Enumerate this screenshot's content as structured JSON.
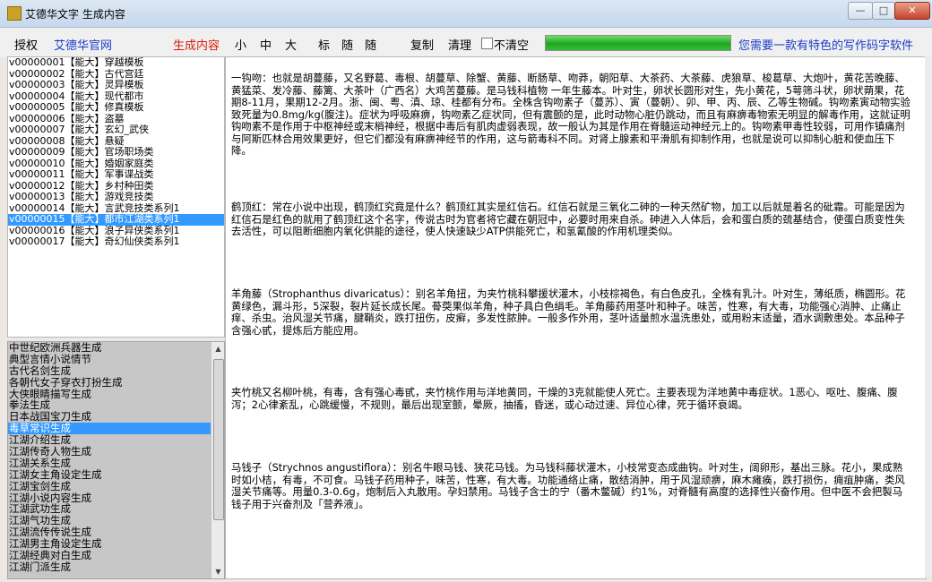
{
  "window": {
    "title": "艾德华文字 生成内容",
    "min": "—",
    "max": "□",
    "close": "✕"
  },
  "toolbar": {
    "auth": "授权",
    "site": "艾德华官网",
    "gen": "生成内容",
    "small": "小",
    "medium": "中",
    "large": "大",
    "standard": "标",
    "random": "随",
    "chaos": "随",
    "copy": "复制",
    "clear": "清理",
    "no_clear": "不清空",
    "progress": 1.0,
    "slogan": "您需要一款有特色的写作码字软件"
  },
  "templates": [
    "v00000001【能大】穿越模板",
    "v00000002【能大】古代宫廷",
    "v00000003【能大】灵异模板",
    "v00000004【能大】现代都市",
    "v00000005【能大】修真模板",
    "v00000006【能大】盗墓",
    "v00000007【能大】玄幻_武侠",
    "v00000008【能大】悬疑",
    "v00000009【能大】官场职场类",
    "v00000010【能大】婚姻家庭类",
    "v00000011【能大】军事谍战类",
    "v00000012【能大】乡村种田类",
    "v00000013【能大】游戏竞技类",
    "v00000014【能大】言武竞技类系列1",
    "v00000015【能大】都市江湖类系列1",
    "v00000016【能大】浪子异侠类系列1",
    "v00000017【能大】奇幻仙侠类系列1"
  ],
  "generators": [
    "中世纪欧洲兵器生成",
    "典型言情小说情节",
    "古代名剑生成",
    "各朝代女子穿衣打扮生成",
    "大侠眼睛描写生成",
    "拳法生成",
    "日本战国宝刀生成",
    "毒草常识生成",
    "江湖介绍生成",
    "江湖传奇人物生成",
    "江湖关系生成",
    "江湖女主角设定生成",
    "江湖宝剑生成",
    "江湖小说内容生成",
    "江湖武功生成",
    "江湖气功生成",
    "江湖流传传说生成",
    "江湖男主角设定生成",
    "江湖经典对白生成",
    "江湖门派生成"
  ],
  "content": [
    "一钩吻：也就是胡蔓藤，又名野葛、毒根、胡蔓草、除蟹、黄藤、断肠草、吻莽，朝阳草、大茶药、大茶藤、虎狼草、梭葛草、大炮叶，黄花苦晚藤、黄猛菜、发冷藤、藤篱、大茶叶（广西名）大鸡苦蔓藤。是马钱科植物 一年生藤本。叶对生，卵状长圆形对生，先小黄花，5萼筛斗状，卵状蒴果，花期8-11月，果期12-2月。浙、闽、粤、滇、琼、桂都有分布。全株含钩吻素子（蔓苏）、寅（蔓朝）、卯、甲、丙、辰、乙等生物碱。钩吻素寅动物实验致死量为0.8mg/kg(腹注)。症状为呼吸麻痹，钩吻素乙症状同，但有震颤的是，此时动物心脏仍跳动，而且有麻痹毒物索无明显的解毒作用，这就证明钩吻素不是作用于中枢神经或末梢神经，根据中毒后有肌肉虚弱表现，故一般认为其是作用在脊髓运动神经元上的。钩吻素甲毒性较弱，可用作镇痛剂与阿斯匹林合用效果更好，但它们都没有麻痹神经节的作用，这与箭毒科不同。对肾上腺素和平滑肌有抑制作用，也就是说可以抑制心脏和使血压下降。",
    "鹤顶红：常在小说中出现，鹤顶红究竟是什么？鹤顶红其实是红信石。红信石就是三氧化二砷的一种天然矿物，加工以后就是着名的砒霜。可能是因为红信石是红色的就用了鹤顶红这个名字，传说古时为官者将它藏在朝冠中，必要时用来自杀。砷进入人体后，会和蛋白质的巯基结合，使蛋白质变性失去活性，可以阻断细胞内氧化供能的途径，使人快速缺少ATP供能死亡，和氢氰酸的作用机理类似。",
    "羊角藤（Strophanthus divaricatus）：别名羊角扭，为夹竹桃科攀援状灌木，小枝棕褐色，有白色皮孔，全株有乳汁。叶对生，薄纸质，椭圆形。花黄绿色，漏斗形，5深裂，裂片延长成长尾。蓇葖果似羊角，种子具白色绢毛。羊角藤药用茎叶和种子。味苦，性寒，有大毒，功能强心消肿、止痛止痒、杀虫。治风湿关节痛，腱鞘炎，跌打扭伤，皮癣，多发性脓肿。一般多作外用，茎叶适量煎水温洗患处，或用粉末适量，酒水调敷患处。本品种子含强心甙，提炼后方能应用。",
    "夹竹桃又名柳叶桃，有毒，含有强心毒甙，夹竹桃作用与洋地黄同，干燥的3克就能使人死亡。主要表现为洋地黄中毒症状。1恶心、呕吐、腹痛、腹泻；2心律紊乱，心跳缓慢，不规则，最后出现室颤，晕厥，抽搐，昏迷，或心动过速、异位心律，死于循环衰竭。",
    "马钱子（Strychnos angustiflora）：别名牛眼马钱、狭花马钱。为马钱科藤状灌木，小枝常变态成曲钩。叶对生，阔卵形，基出三脉。花小，果成熟时如小桔，有毒，不可食。马钱子药用种子，味苦，性寒，有大毒。功能通络止痛，散结消肿，用于风湿顽痹，麻木瘫痪，跌打损伤，痈疽肿痛，类风湿关节痛等。用量0.3-0.6g，炮制后入丸散用。孕妇禁用。马钱子含士的宁（番木鳖碱）约1%，对脊髓有高度的选择性兴奋作用。但中医不会把製马钱子用于兴奋剂及「营养液」。"
  ]
}
